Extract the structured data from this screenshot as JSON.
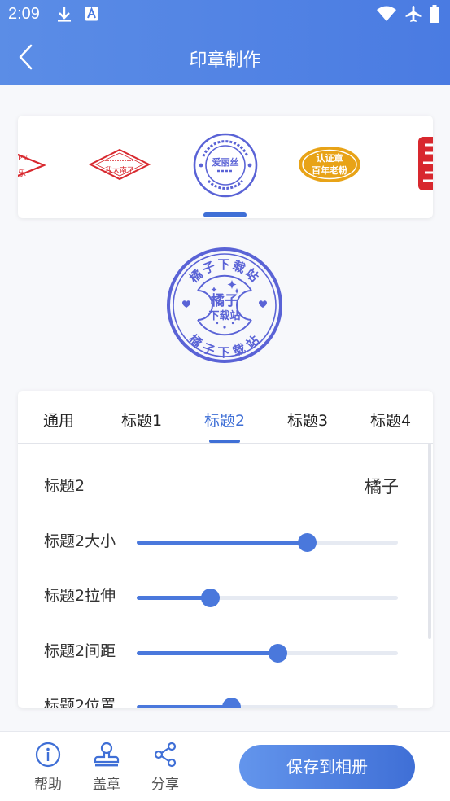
{
  "status_bar": {
    "time": "2:09"
  },
  "header": {
    "title": "印章制作"
  },
  "carousel": {
    "stamps": [
      {
        "name": "partial-left-stamp",
        "texts": [
          "PY",
          "乐"
        ]
      },
      {
        "name": "red-diamond-stamp",
        "texts": [
          "我太南了"
        ]
      },
      {
        "name": "blue-round-stamp",
        "texts": [
          "爱丽丝"
        ]
      },
      {
        "name": "gold-oval-stamp",
        "texts": [
          "认证章",
          "百年老粉"
        ]
      },
      {
        "name": "partial-red-stamp",
        "texts": []
      }
    ],
    "selected_index": 2
  },
  "preview_stamp": {
    "title_line1": "橘子",
    "title_line2": "下载站",
    "ring_text": "橘子下载站",
    "color": "#5a63d6"
  },
  "tabs": [
    "通用",
    "标题1",
    "标题2",
    "标题3",
    "标题4"
  ],
  "active_tab_index": 2,
  "settings": {
    "title_label": "标题2",
    "title_value": "橘子",
    "sliders": [
      {
        "label": "标题2大小",
        "value": 0.65
      },
      {
        "label": "标题2拉伸",
        "value": 0.28
      },
      {
        "label": "标题2间距",
        "value": 0.54
      },
      {
        "label": "标题2位置",
        "value": 0.36
      }
    ]
  },
  "bottom_bar": {
    "help": "帮助",
    "stamp": "盖章",
    "share": "分享",
    "save": "保存到相册"
  },
  "colors": {
    "accent": "#3f6fd6",
    "header": "#4a7be2",
    "stamp_blue": "#5a63d6",
    "stamp_red": "#d8282e",
    "stamp_gold": "#e8a317"
  }
}
